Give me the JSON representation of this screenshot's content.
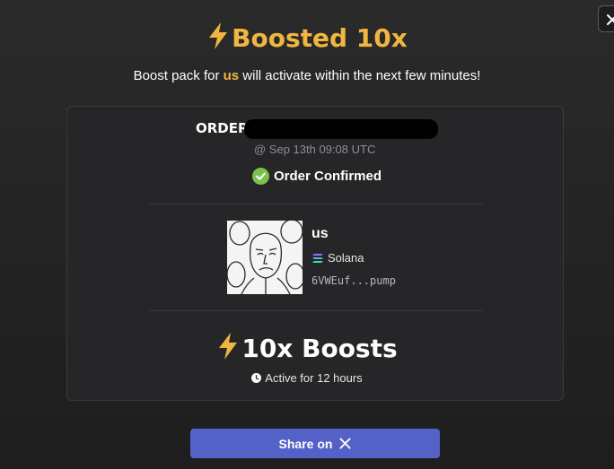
{
  "header": {
    "title": "Boosted 10x",
    "subtitle_prefix": "Boost pack for ",
    "subtitle_token": "us",
    "subtitle_suffix": " will activate within the next few minutes!"
  },
  "order": {
    "label": "ORDER #",
    "timestamp": "@ Sep 13th 09:08 UTC",
    "status": "Order Confirmed"
  },
  "token": {
    "name": "us",
    "chain": "Solana",
    "address": "6VWEuf...pump"
  },
  "boost": {
    "headline": "10x Boosts",
    "duration": "Active for 12 hours"
  },
  "share": {
    "label": "Share on"
  },
  "colors": {
    "accent": "#f0b640",
    "confirmed": "#7bc24a",
    "button": "#5462c7"
  },
  "icons": [
    "close-icon",
    "bolt-icon",
    "check-circle-icon",
    "solana-icon",
    "clock-icon",
    "x-logo-icon"
  ]
}
